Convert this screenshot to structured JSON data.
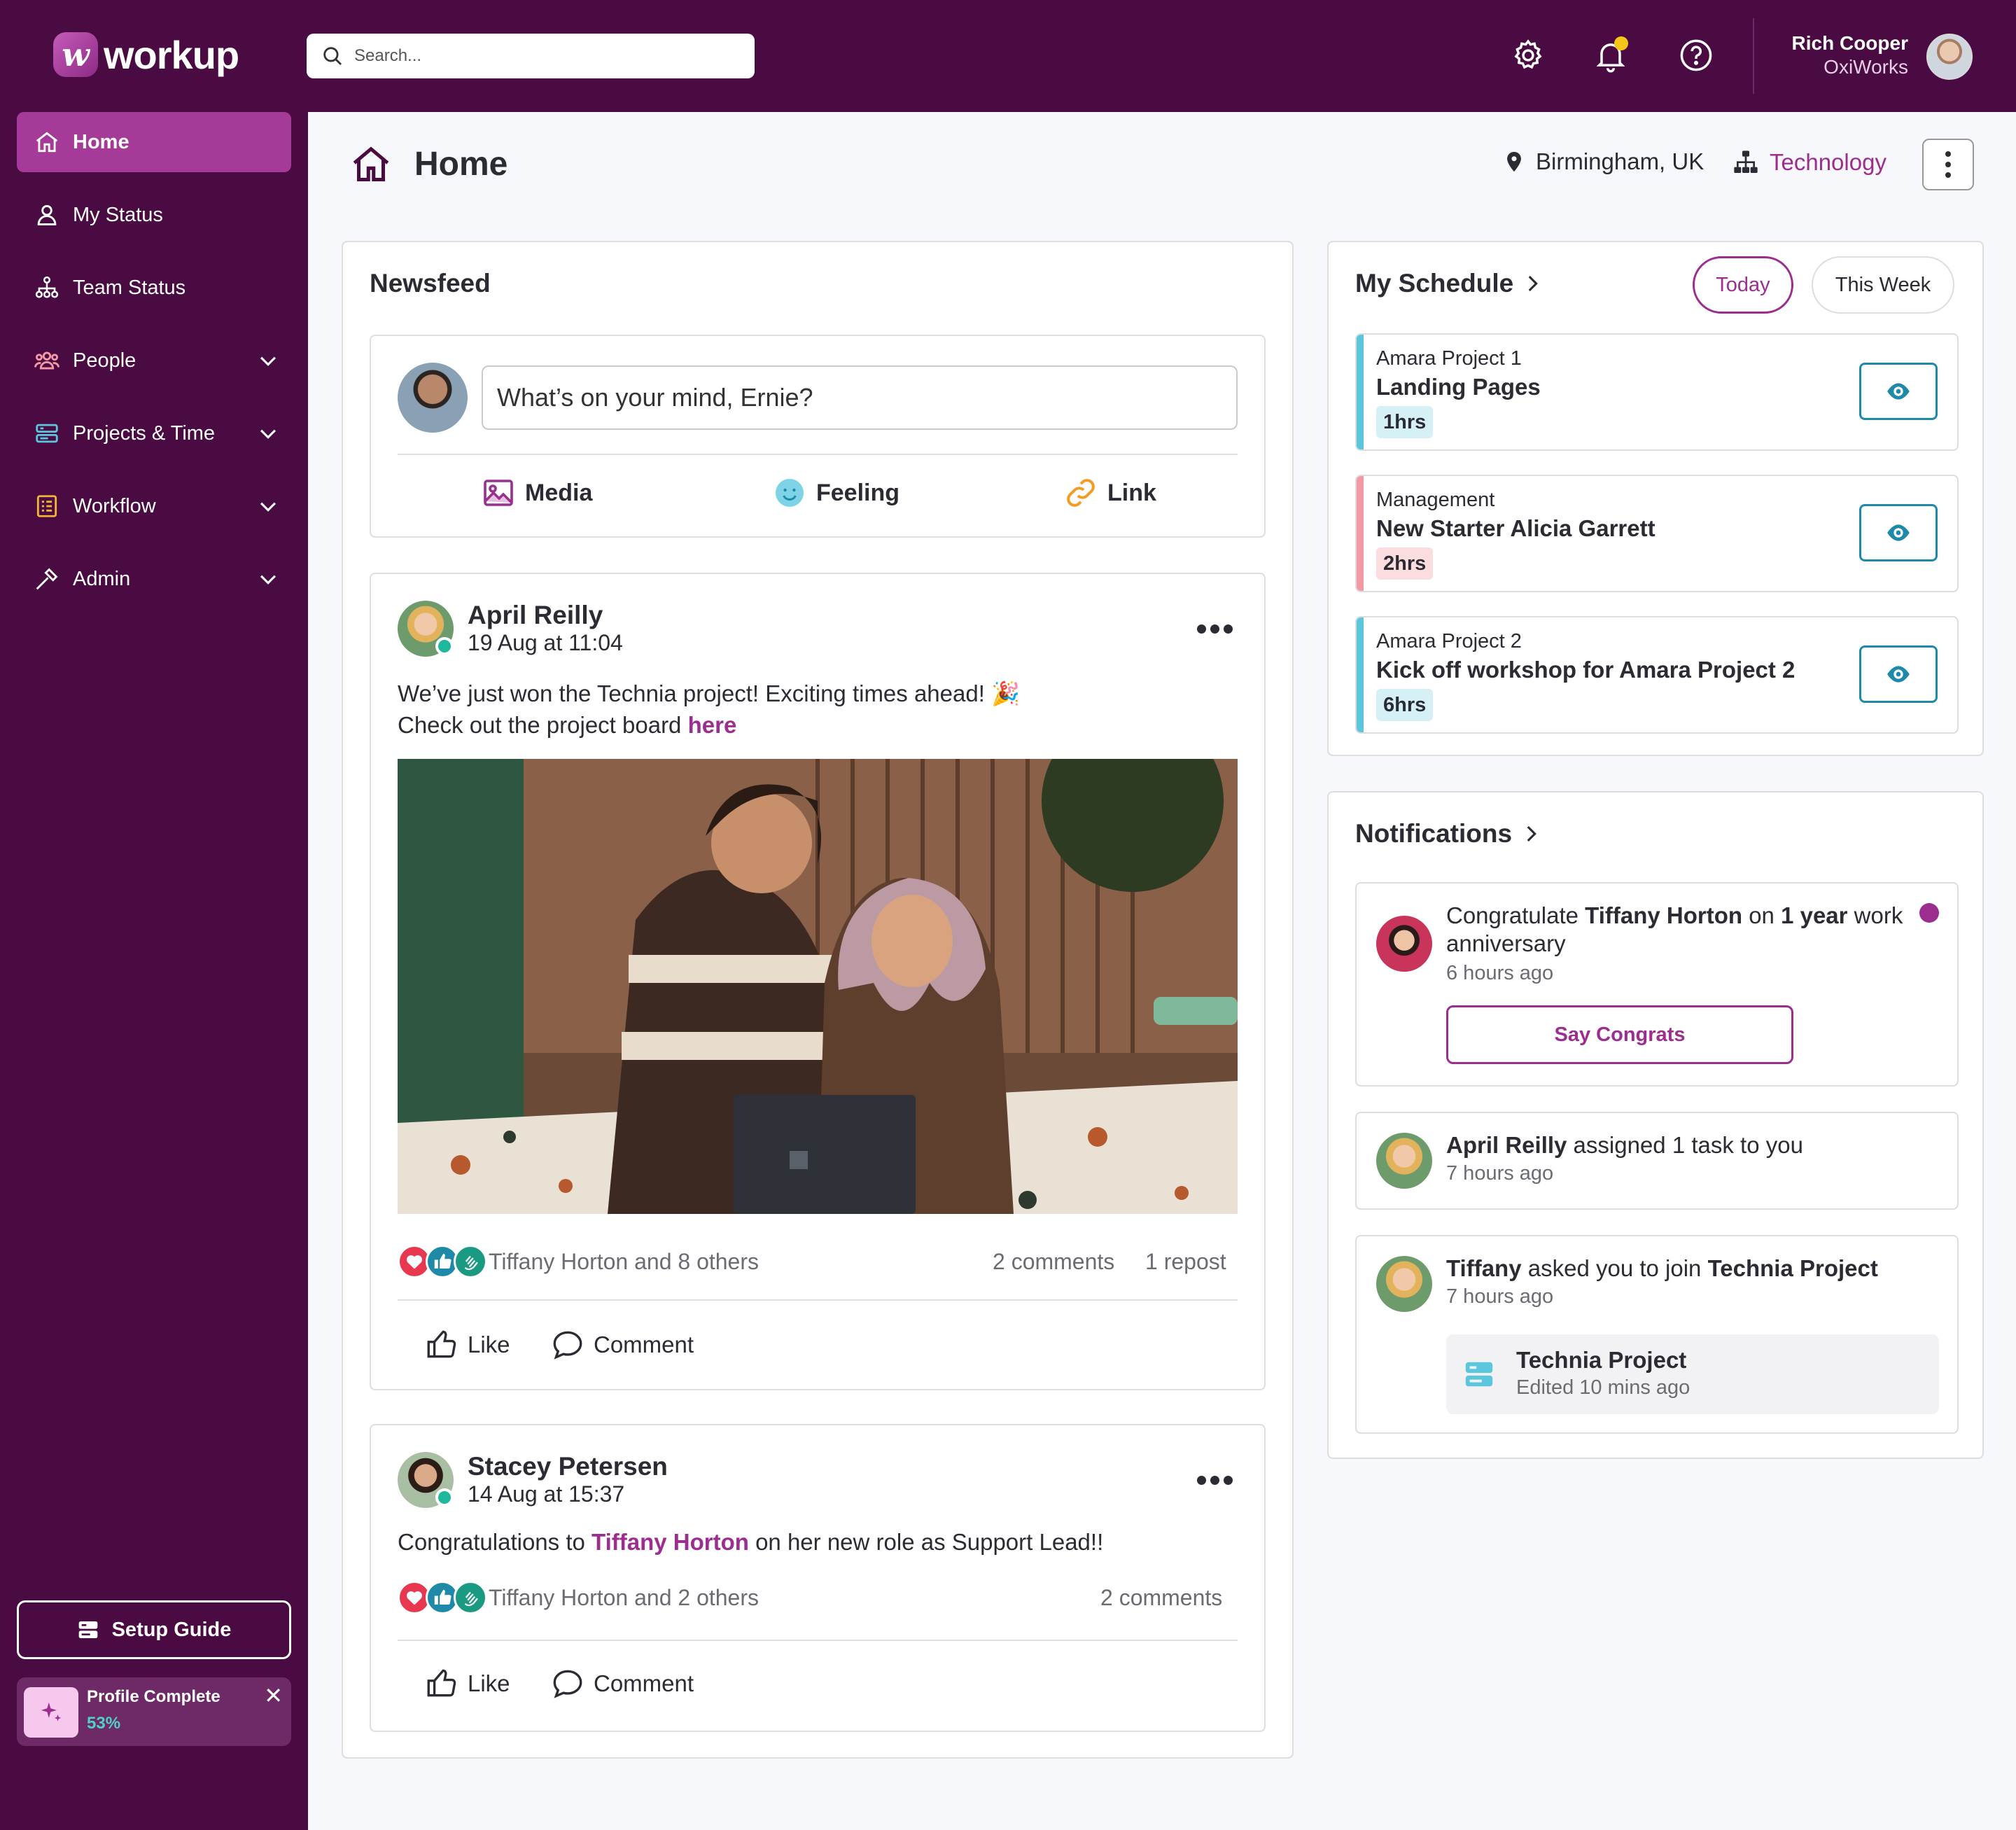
{
  "app": {
    "name": "workup",
    "logo_letter": "w"
  },
  "search": {
    "placeholder": "Search..."
  },
  "user": {
    "name": "Rich Cooper",
    "org": "OxiWorks"
  },
  "sidebar": {
    "items": [
      {
        "label": "Home",
        "icon": "home-icon",
        "active": true
      },
      {
        "label": "My Status",
        "icon": "user-icon"
      },
      {
        "label": "Team Status",
        "icon": "org-chart-icon"
      },
      {
        "label": "People",
        "icon": "people-icon",
        "expandable": true
      },
      {
        "label": "Projects & Time",
        "icon": "projects-icon",
        "expandable": true
      },
      {
        "label": "Workflow",
        "icon": "checklist-icon",
        "expandable": true
      },
      {
        "label": "Admin",
        "icon": "hammer-icon",
        "expandable": true
      }
    ],
    "setup_guide": "Setup Guide",
    "profile": {
      "title": "Profile Complete",
      "percent": "53%",
      "value": 0.53
    }
  },
  "page": {
    "title": "Home",
    "location": "Birmingham, UK",
    "department": "Technology"
  },
  "newsfeed": {
    "title": "Newsfeed",
    "composer": {
      "placeholder": "What’s on your mind, Ernie?",
      "actions": [
        "Media",
        "Feeling",
        "Link"
      ]
    },
    "posts": [
      {
        "author": "April Reilly",
        "time": "19 Aug at 11:04",
        "text_line1": "We’ve just won the Technia project! Exciting times ahead! 🎉",
        "text_line2_prefix": "Check out the project board ",
        "text_line2_link": "here",
        "reactions_text": "Tiffany Horton and 8 others",
        "comments": "2 comments",
        "reposts": "1 repost",
        "like": "Like",
        "comment": "Comment"
      },
      {
        "author": "Stacey Petersen",
        "time": "14 Aug at 15:37",
        "text_prefix": "Congratulations to ",
        "text_mention": "Tiffany Horton",
        "text_suffix": " on her new role as Support Lead!!",
        "reactions_text": "Tiffany Horton and 2 others",
        "comments": "2 comments",
        "like": "Like",
        "comment": "Comment"
      }
    ]
  },
  "schedule": {
    "title": "My Schedule",
    "tabs": [
      "Today",
      "This Week"
    ],
    "active_tab": "Today",
    "items": [
      {
        "project": "Amara Project 1",
        "title": "Landing Pages",
        "duration": "1hrs",
        "color": "#5cc6dc",
        "badge_bg": "#d6f1f6"
      },
      {
        "project": "Management",
        "title": "New Starter Alicia Garrett",
        "duration": "2hrs",
        "color": "#f39aa4",
        "badge_bg": "#fbdde0"
      },
      {
        "project": "Amara Project 2",
        "title": "Kick off workshop for Amara Project 2",
        "duration": "6hrs",
        "color": "#5cc6dc",
        "badge_bg": "#d6f1f6"
      }
    ]
  },
  "notifications": {
    "title": "Notifications",
    "items": [
      {
        "pre": "Congratulate ",
        "name": "Tiffany Horton",
        "mid": " on ",
        "bold2": "1 year",
        "post": " work",
        "line2": "anniversary",
        "time": "6 hours ago",
        "button": "Say Congrats",
        "unread": true
      },
      {
        "name": "April Reilly",
        "post": " assigned 1 task to you",
        "time": "7 hours ago"
      },
      {
        "name": "Tiffany",
        "mid": " asked you to join ",
        "bold2": "Technia Project",
        "time": "7 hours ago",
        "chip_title": "Technia Project",
        "chip_sub": "Edited 10 mins ago"
      }
    ]
  },
  "colors": {
    "brand": "#4a0a42",
    "accent": "#9b2e8f",
    "active_nav": "#a63a98",
    "teal": "#1e8aa8"
  }
}
